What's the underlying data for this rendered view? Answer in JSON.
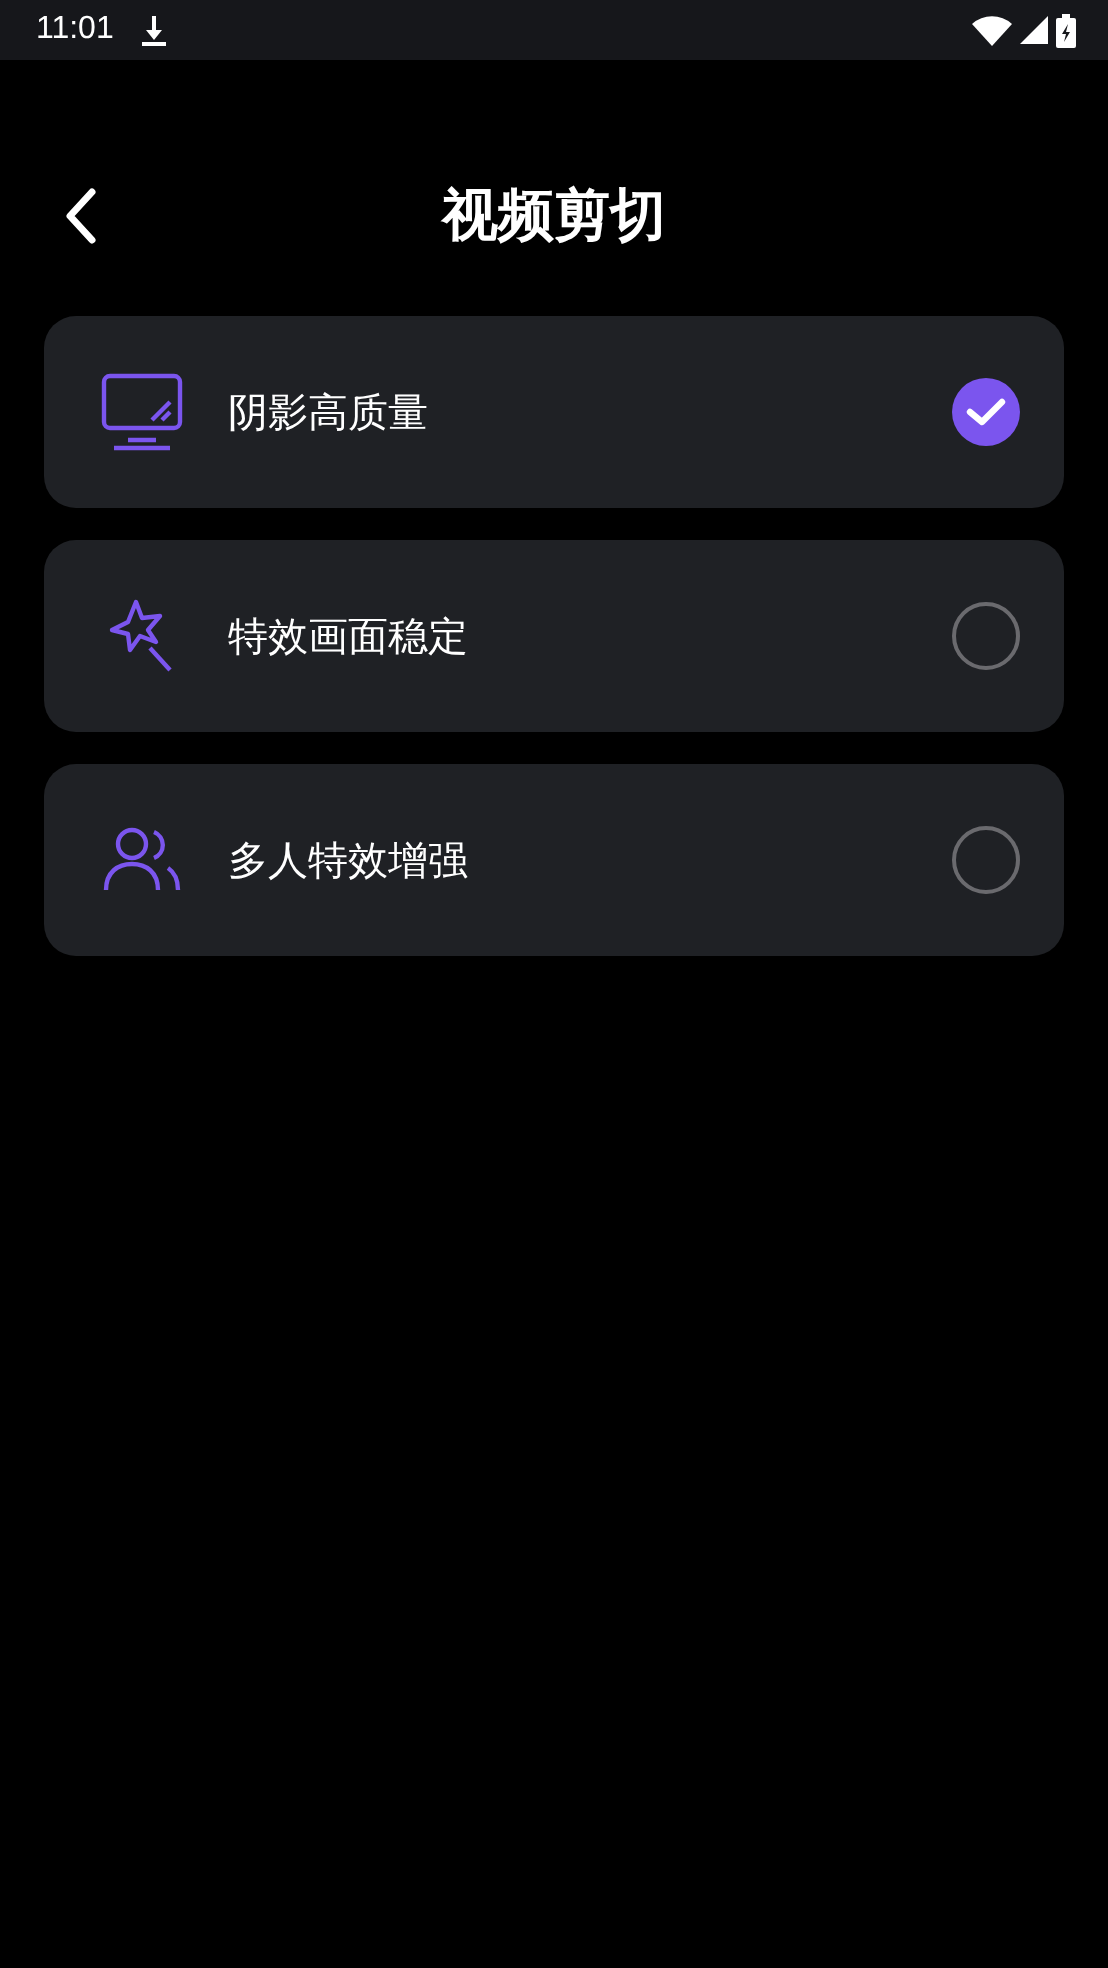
{
  "status_bar": {
    "time": "11:01"
  },
  "header": {
    "title": "视频剪切"
  },
  "options": [
    {
      "kind": "monitor",
      "label": "阴影高质量",
      "selected": true
    },
    {
      "kind": "wand",
      "label": "特效画面稳定",
      "selected": false
    },
    {
      "kind": "people",
      "label": "多人特效增强",
      "selected": false
    }
  ]
}
